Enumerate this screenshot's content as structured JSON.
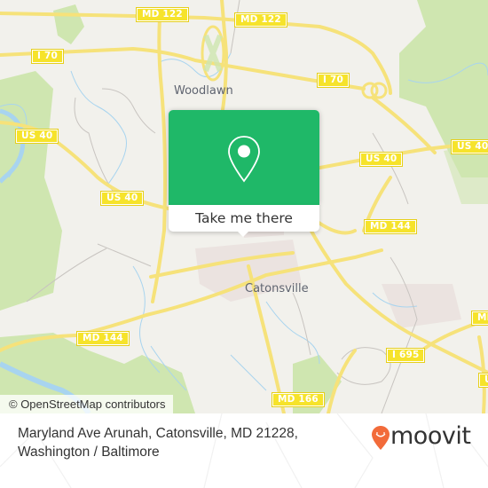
{
  "map": {
    "place_labels": {
      "woodlawn": "Woodlawn",
      "catonsville": "Catonsville"
    },
    "road_shields": {
      "md122_left": "MD 122",
      "md122_right": "MD 122",
      "i70_left": "I 70",
      "i70_right": "I 70",
      "us40_far_left": "US 40",
      "us40_left": "US 40",
      "us40_center": "US 40",
      "us40_right": "US 40",
      "md144_left": "MD 144",
      "md144_right": "MD 144",
      "md166": "MD 166",
      "i695": "I 695",
      "md_edge": "MD",
      "us_edge": "U"
    },
    "attribution": "© OpenStreetMap contributors",
    "colors": {
      "background": "#f2f1ec",
      "road": "#f6e27a",
      "park": "#cfe6b0",
      "water": "#a8d4ef",
      "shield": "#f6e32b"
    }
  },
  "popup": {
    "icon": "map-pin-icon",
    "button_label": "Take me there",
    "accent": "#1fb868"
  },
  "footer": {
    "address_line1": "Maryland Ave Arunah, Catonsville, MD 21228,",
    "address_line2": "Washington / Baltimore",
    "brand": "moovit",
    "brand_color": "#f26b3a"
  }
}
